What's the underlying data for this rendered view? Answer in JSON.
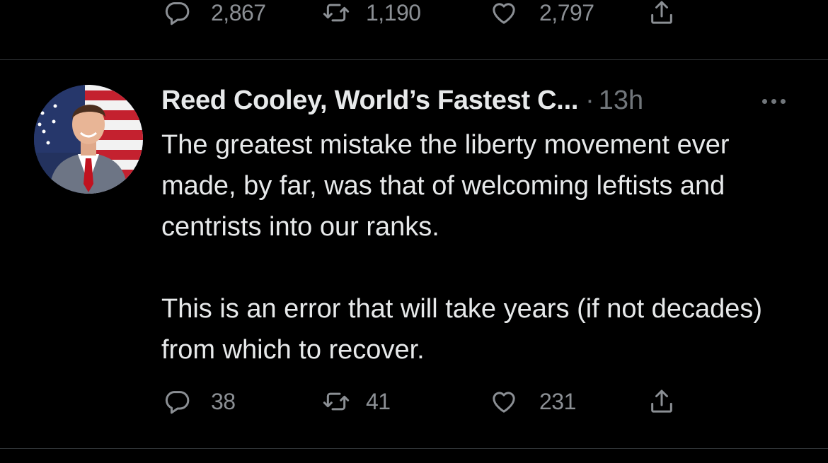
{
  "previous_tweet": {
    "actions": {
      "reply": {
        "icon": "reply-icon",
        "count": "2,867"
      },
      "retweet": {
        "icon": "retweet-icon",
        "count": "1,190"
      },
      "like": {
        "icon": "heart-icon",
        "count": "2,797"
      },
      "share": {
        "icon": "share-icon"
      }
    }
  },
  "tweet": {
    "author": {
      "display_name": "Reed Cooley, World’s Fastest C...",
      "avatar": "profile-photo-with-american-flag"
    },
    "separator": "·",
    "timestamp": "13h",
    "text": [
      "The greatest mistake the liberty movement ever made, by far, was that of welcoming leftists and centrists into our ranks.",
      "This is an error that will take years (if not decades) from which to recover."
    ],
    "actions": {
      "reply": {
        "icon": "reply-icon",
        "count": "38"
      },
      "retweet": {
        "icon": "retweet-icon",
        "count": "41"
      },
      "like": {
        "icon": "heart-icon",
        "count": "231"
      },
      "share": {
        "icon": "share-icon"
      }
    },
    "more_icon": "more-options-icon"
  },
  "colors": {
    "background": "#000000",
    "primary_text": "#e7e9ea",
    "secondary_text": "#71767b",
    "divider": "#2f3336"
  }
}
